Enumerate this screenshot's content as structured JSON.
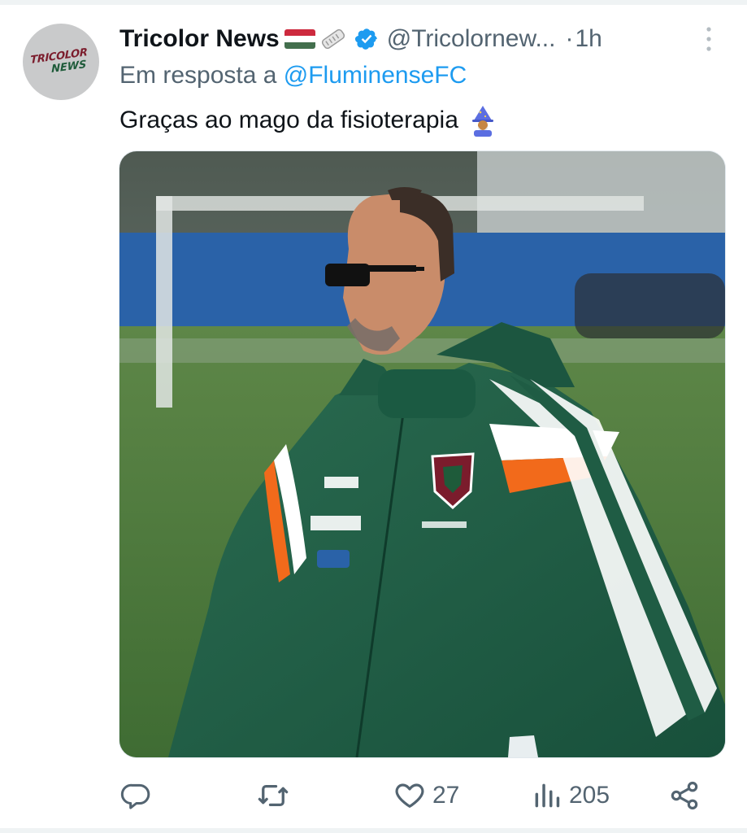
{
  "tweet": {
    "author": {
      "avatar_text_line1": "TRICOLOR",
      "avatar_text_line2": "NEWS",
      "display_name": "Tricolor News",
      "handle": "@Tricolornew...",
      "verified": true
    },
    "separator": "·",
    "timestamp": "1h",
    "reply_prefix": "Em resposta a",
    "reply_to": "@FluminenseFC",
    "text": "Graças ao mago da fisioterapia",
    "emoji_icons": [
      "hungary-flag-icon",
      "rolled-newspaper-icon",
      "mage-icon"
    ]
  },
  "actions": {
    "reply": {
      "icon": "reply-icon",
      "count": ""
    },
    "retweet": {
      "icon": "retweet-icon",
      "count": ""
    },
    "like": {
      "icon": "heart-icon",
      "count": "27"
    },
    "views": {
      "icon": "views-icon",
      "count": "205"
    },
    "share": {
      "icon": "share-icon",
      "count": ""
    }
  },
  "colors": {
    "text_primary": "#0f1419",
    "text_secondary": "#536471",
    "link": "#1d9bf0",
    "verified_badge": "#1d9bf0",
    "jacket_green": "#1f5c44",
    "field_green": "#4a7a3a",
    "accent_orange": "#f26a1b"
  }
}
